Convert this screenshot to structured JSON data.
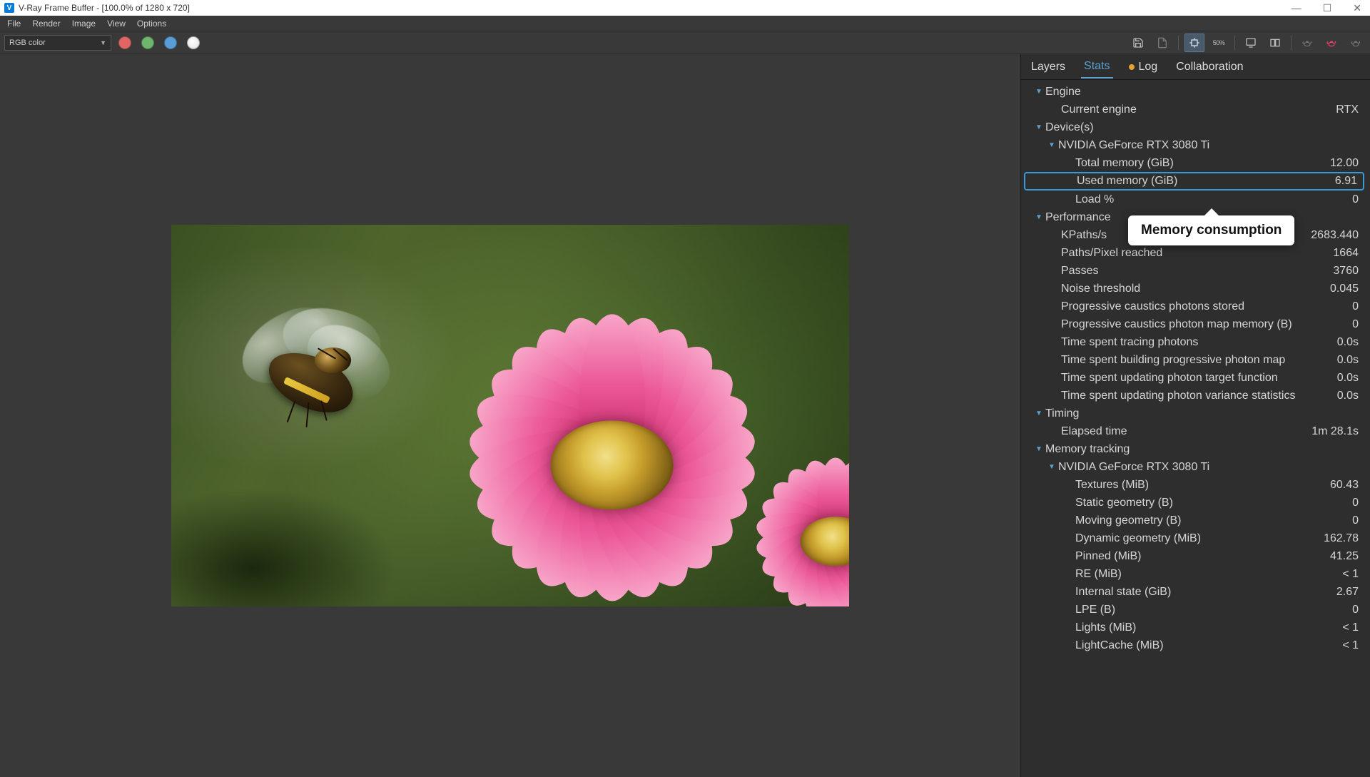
{
  "titlebar": {
    "app_icon_letter": "V",
    "title": "V-Ray Frame Buffer - [100.0% of 1280 x 720]"
  },
  "win_ctrls": {
    "min": "—",
    "max": "☐",
    "close": "✕"
  },
  "menubar": [
    "File",
    "Render",
    "Image",
    "View",
    "Options"
  ],
  "toolbar": {
    "channel": "RGB color",
    "zoom_label": "50%"
  },
  "tabs": {
    "layers": "Layers",
    "stats": "Stats",
    "log": "Log",
    "collaboration": "Collaboration"
  },
  "callout": "Memory consumption",
  "stats": {
    "engine": {
      "title": "Engine",
      "current_engine_label": "Current engine",
      "current_engine_value": "RTX"
    },
    "devices": {
      "title": "Device(s)",
      "device0": {
        "name": "NVIDIA GeForce RTX 3080 Ti",
        "total_mem_label": "Total memory (GiB)",
        "total_mem_value": "12.00",
        "used_mem_label": "Used memory (GiB)",
        "used_mem_value": "6.91",
        "load_label": "Load %",
        "load_value": "0"
      }
    },
    "performance": {
      "title": "Performance",
      "kpaths_label": "KPaths/s",
      "kpaths_value": "2683.440",
      "ppx_label": "Paths/Pixel reached",
      "ppx_value": "1664",
      "passes_label": "Passes",
      "passes_value": "3760",
      "noise_label": "Noise threshold",
      "noise_value": "0.045",
      "pcps_label": "Progressive caustics photons stored",
      "pcps_value": "0",
      "pcpmm_label": "Progressive caustics photon map memory (B)",
      "pcpmm_value": "0",
      "ttp_label": "Time spent tracing photons",
      "ttp_value": "0.0s",
      "tbppm_label": "Time spent building progressive photon map",
      "tbppm_value": "0.0s",
      "tuptf_label": "Time spent updating photon target function",
      "tuptf_value": "0.0s",
      "tupvs_label": "Time spent updating photon variance statistics",
      "tupvs_value": "0.0s"
    },
    "timing": {
      "title": "Timing",
      "elapsed_label": "Elapsed time",
      "elapsed_value": "1m 28.1s"
    },
    "memory_tracking": {
      "title": "Memory tracking",
      "device0": {
        "name": "NVIDIA GeForce RTX 3080 Ti",
        "textures_label": "Textures (MiB)",
        "textures_value": "60.43",
        "static_label": "Static geometry (B)",
        "static_value": "0",
        "moving_label": "Moving geometry (B)",
        "moving_value": "0",
        "dynamic_label": "Dynamic geometry (MiB)",
        "dynamic_value": "162.78",
        "pinned_label": "Pinned (MiB)",
        "pinned_value": "41.25",
        "re_label": "RE (MiB)",
        "re_value": "< 1",
        "internal_label": "Internal state (GiB)",
        "internal_value": "2.67",
        "lpe_label": "LPE (B)",
        "lpe_value": "0",
        "lights_label": "Lights (MiB)",
        "lights_value": "< 1",
        "lightcache_label": "LightCache (MiB)",
        "lightcache_value": "< 1"
      }
    }
  }
}
